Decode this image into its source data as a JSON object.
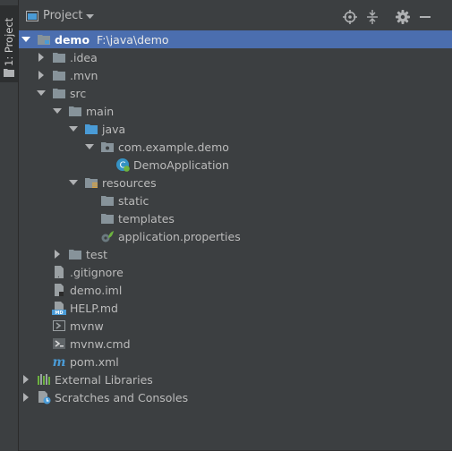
{
  "toolstrip": {
    "tab_label": "1: Project"
  },
  "header": {
    "title": "Project",
    "buttons": [
      "locate-icon",
      "collapse-all-icon",
      "settings-icon",
      "hide-icon"
    ]
  },
  "tree": [
    {
      "label": "demo",
      "path": "F:\\java\\demo",
      "icon": "module-folder-icon",
      "expanded": true,
      "selected": true
    },
    {
      "label": ".idea",
      "icon": "folder-icon",
      "expanded": false
    },
    {
      "label": ".mvn",
      "icon": "folder-icon",
      "expanded": false
    },
    {
      "label": "src",
      "icon": "folder-icon",
      "expanded": true
    },
    {
      "label": "main",
      "icon": "folder-icon",
      "expanded": true
    },
    {
      "label": "java",
      "icon": "source-folder-icon",
      "expanded": true
    },
    {
      "label": "com.example.demo",
      "icon": "package-icon",
      "expanded": true
    },
    {
      "label": "DemoApplication",
      "icon": "spring-class-icon"
    },
    {
      "label": "resources",
      "icon": "resources-folder-icon",
      "expanded": true
    },
    {
      "label": "static",
      "icon": "folder-icon"
    },
    {
      "label": "templates",
      "icon": "folder-icon"
    },
    {
      "label": "application.properties",
      "icon": "spring-properties-icon"
    },
    {
      "label": "test",
      "icon": "folder-icon",
      "expanded": false
    },
    {
      "label": ".gitignore",
      "icon": "file-icon"
    },
    {
      "label": "demo.iml",
      "icon": "iml-file-icon"
    },
    {
      "label": "HELP.md",
      "icon": "markdown-file-icon"
    },
    {
      "label": "mvnw",
      "icon": "shell-script-icon"
    },
    {
      "label": "mvnw.cmd",
      "icon": "cmd-file-icon"
    },
    {
      "label": "pom.xml",
      "icon": "maven-icon"
    },
    {
      "label": "External Libraries",
      "icon": "libraries-icon",
      "expanded": false
    },
    {
      "label": "Scratches and Consoles",
      "icon": "scratches-icon",
      "expanded": false
    }
  ],
  "colors": {
    "background": "#3c3f41",
    "selection": "#4b6eaf",
    "folder": "#87939a",
    "source_folder": "#4a9bd6",
    "spring_green": "#6db33f",
    "text": "#bbbbbb"
  }
}
